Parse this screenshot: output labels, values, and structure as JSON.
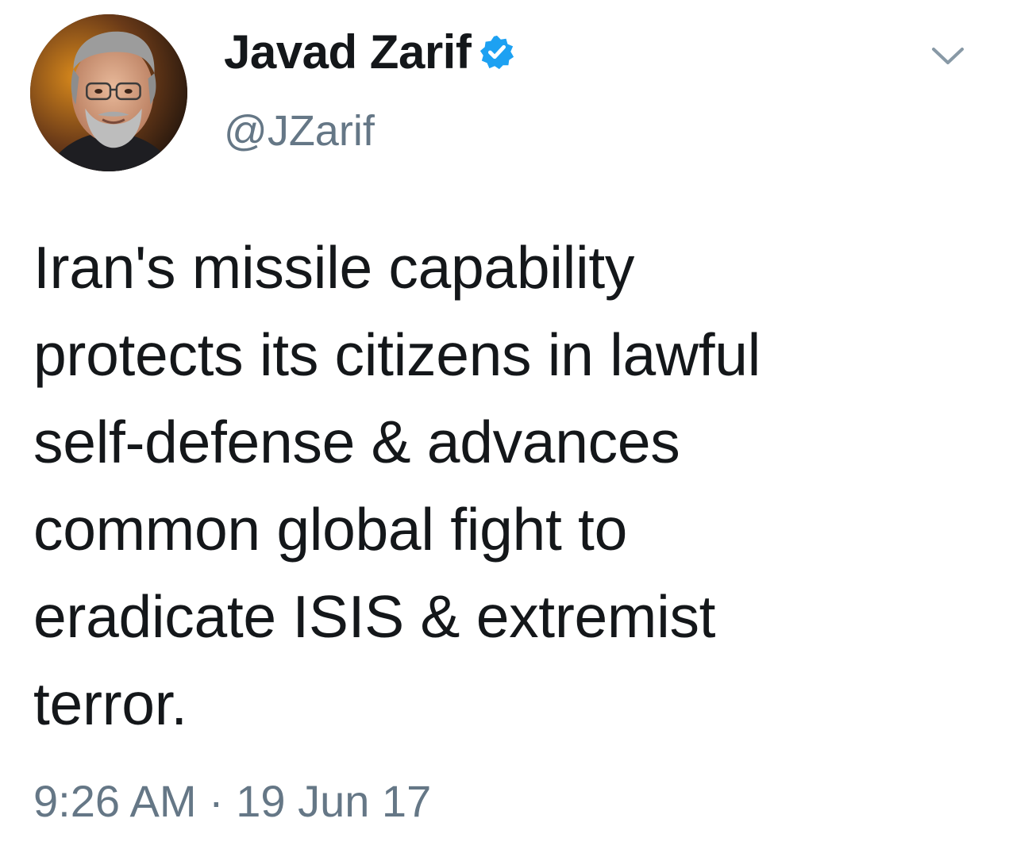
{
  "tweet": {
    "author": {
      "display_name": "Javad Zarif",
      "handle": "@JZarif",
      "verified": true,
      "avatar_icon": "profile-photo",
      "verified_icon": "verified-badge-icon",
      "verified_color": "#1da1f2"
    },
    "menu_icon": "chevron-down-icon",
    "text": "Iran's missile capability\nprotects its citizens in lawful\nself-defense & advances\ncommon global fight to\neradicate ISIS & extremist\nterror.",
    "timestamp": "9:26 AM · 19 Jun 17"
  },
  "colors": {
    "text_primary": "#14171a",
    "text_secondary": "#657786",
    "background": "#ffffff"
  }
}
